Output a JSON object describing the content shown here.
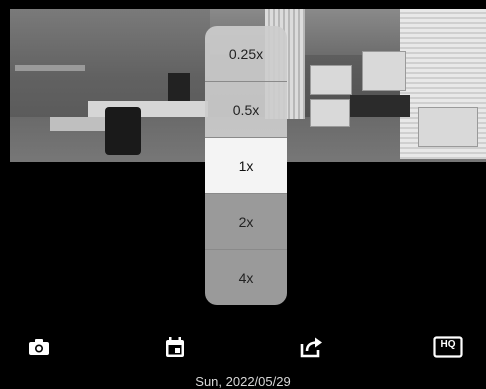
{
  "zoom": {
    "options": [
      "0.25x",
      "0.5x",
      "1x",
      "2x",
      "4x"
    ],
    "selected": "1x"
  },
  "toolbar": {
    "icons": [
      "camera-icon",
      "calendar-icon",
      "share-icon",
      "hq-icon"
    ],
    "hq_label": "HQ"
  },
  "footer": {
    "date": "Sun, 2022/05/29"
  },
  "colors": {
    "background": "#000000",
    "selected_option": "#f4f4f4",
    "option": "#cccccc",
    "dark_option": "#9a9a9a",
    "icon": "#ffffff"
  }
}
